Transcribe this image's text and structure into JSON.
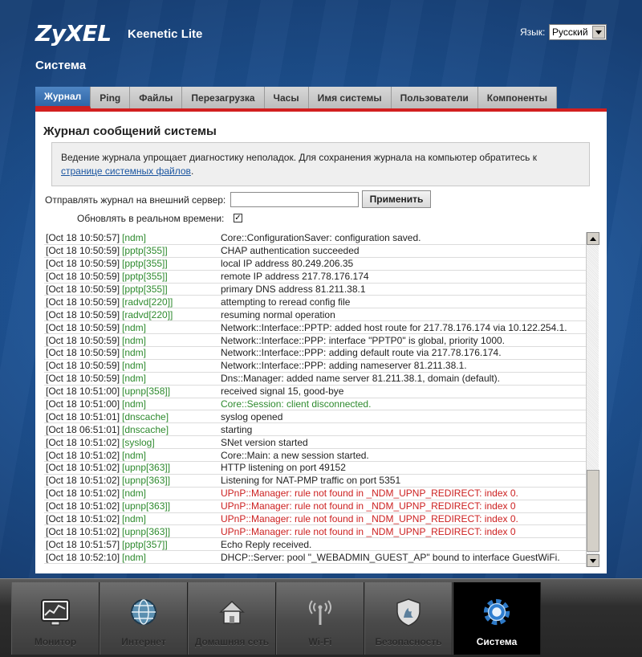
{
  "header": {
    "brand": "ZyXEL",
    "model": "Keenetic Lite",
    "language_label": "Язык:",
    "language_value": "Русский",
    "section_title": "Система"
  },
  "tabs": [
    {
      "label": "Журнал",
      "active": true
    },
    {
      "label": "Ping",
      "active": false
    },
    {
      "label": "Файлы",
      "active": false
    },
    {
      "label": "Перезагрузка",
      "active": false
    },
    {
      "label": "Часы",
      "active": false
    },
    {
      "label": "Имя системы",
      "active": false
    },
    {
      "label": "Пользователи",
      "active": false
    },
    {
      "label": "Компоненты",
      "active": false
    }
  ],
  "panel": {
    "title": "Журнал сообщений системы",
    "info_text": "Ведение журнала упрощает диагностику неполадок. Для сохранения журнала на компьютер обратитесь к ",
    "info_link": "странице системных файлов",
    "info_tail": ".",
    "send_label": "Отправлять журнал на внешний сервер:",
    "send_value": "",
    "apply_label": "Применить",
    "realtime_label": "Обновлять в реальном времени:",
    "realtime_checked": true,
    "realtime_mark": "✓"
  },
  "log": [
    {
      "ts": "[Oct 18 10:50:57]",
      "src": "[ndm]",
      "msg": "Core::ConfigurationSaver: configuration saved.",
      "level": "normal"
    },
    {
      "ts": "[Oct 18 10:50:59]",
      "src": "[pptp[355]]",
      "msg": "CHAP authentication succeeded",
      "level": "normal"
    },
    {
      "ts": "[Oct 18 10:50:59]",
      "src": "[pptp[355]]",
      "msg": "local IP address 80.249.206.35",
      "level": "normal"
    },
    {
      "ts": "[Oct 18 10:50:59]",
      "src": "[pptp[355]]",
      "msg": "remote IP address 217.78.176.174",
      "level": "normal"
    },
    {
      "ts": "[Oct 18 10:50:59]",
      "src": "[pptp[355]]",
      "msg": "primary DNS address 81.211.38.1",
      "level": "normal"
    },
    {
      "ts": "[Oct 18 10:50:59]",
      "src": "[radvd[220]]",
      "msg": "attempting to reread config file",
      "level": "normal"
    },
    {
      "ts": "[Oct 18 10:50:59]",
      "src": "[radvd[220]]",
      "msg": "resuming normal operation",
      "level": "normal"
    },
    {
      "ts": "[Oct 18 10:50:59]",
      "src": "[ndm]",
      "msg": "Network::Interface::PPTP: added host route for 217.78.176.174 via 10.122.254.1.",
      "level": "normal"
    },
    {
      "ts": "[Oct 18 10:50:59]",
      "src": "[ndm]",
      "msg": "Network::Interface::PPP: interface \"PPTP0\" is global, priority 1000.",
      "level": "normal"
    },
    {
      "ts": "[Oct 18 10:50:59]",
      "src": "[ndm]",
      "msg": "Network::Interface::PPP: adding default route via 217.78.176.174.",
      "level": "normal"
    },
    {
      "ts": "[Oct 18 10:50:59]",
      "src": "[ndm]",
      "msg": "Network::Interface::PPP: adding nameserver 81.211.38.1.",
      "level": "normal"
    },
    {
      "ts": "[Oct 18 10:50:59]",
      "src": "[ndm]",
      "msg": "Dns::Manager: added name server 81.211.38.1, domain (default).",
      "level": "normal"
    },
    {
      "ts": "[Oct 18 10:51:00]",
      "src": "[upnp[358]]",
      "msg": "received signal 15, good-bye",
      "level": "normal"
    },
    {
      "ts": "[Oct 18 10:51:00]",
      "src": "[ndm]",
      "msg": "Core::Session: client disconnected.",
      "level": "ok"
    },
    {
      "ts": "[Oct 18 10:51:01]",
      "src": "[dnscache]",
      "msg": "syslog opened",
      "level": "normal"
    },
    {
      "ts": "[Oct 18 06:51:01]",
      "src": "[dnscache]",
      "msg": "starting",
      "level": "normal"
    },
    {
      "ts": "[Oct 18 10:51:02]",
      "src": "[syslog]",
      "msg": "SNet version started",
      "level": "normal"
    },
    {
      "ts": "[Oct 18 10:51:02]",
      "src": "[ndm]",
      "msg": "Core::Main: a new session started.",
      "level": "normal"
    },
    {
      "ts": "[Oct 18 10:51:02]",
      "src": "[upnp[363]]",
      "msg": "HTTP listening on port 49152",
      "level": "normal"
    },
    {
      "ts": "[Oct 18 10:51:02]",
      "src": "[upnp[363]]",
      "msg": "Listening for NAT-PMP traffic on port 5351",
      "level": "normal"
    },
    {
      "ts": "[Oct 18 10:51:02]",
      "src": "[ndm]",
      "msg": "UPnP::Manager: rule not found in _NDM_UPNP_REDIRECT: index 0.",
      "level": "err"
    },
    {
      "ts": "[Oct 18 10:51:02]",
      "src": "[upnp[363]]",
      "msg": "UPnP::Manager: rule not found in _NDM_UPNP_REDIRECT: index 0",
      "level": "err"
    },
    {
      "ts": "[Oct 18 10:51:02]",
      "src": "[ndm]",
      "msg": "UPnP::Manager: rule not found in _NDM_UPNP_REDIRECT: index 0.",
      "level": "err"
    },
    {
      "ts": "[Oct 18 10:51:02]",
      "src": "[upnp[363]]",
      "msg": "UPnP::Manager: rule not found in _NDM_UPNP_REDIRECT: index 0",
      "level": "err"
    },
    {
      "ts": "[Oct 18 10:51:57]",
      "src": "[pptp[357]]",
      "msg": "Echo Reply received.",
      "level": "normal"
    },
    {
      "ts": "[Oct 18 10:52:10]",
      "src": "[ndm]",
      "msg": "DHCP::Server: pool \"_WEBADMIN_GUEST_AP\" bound to interface GuestWiFi.",
      "level": "normal"
    }
  ],
  "dock": [
    {
      "label": "Монитор",
      "icon": "monitor-icon",
      "active": false
    },
    {
      "label": "Интернет",
      "icon": "globe-icon",
      "active": false
    },
    {
      "label": "Домашняя сеть",
      "icon": "home-icon",
      "active": false
    },
    {
      "label": "Wi-Fi",
      "icon": "wifi-icon",
      "active": false
    },
    {
      "label": "Безопасность",
      "icon": "shield-icon",
      "active": false
    },
    {
      "label": "Система",
      "icon": "gear-icon",
      "active": true
    }
  ],
  "colors": {
    "accent_red": "#d21f1f",
    "tab_active": "#3a72b4",
    "source_green": "#2e8a2e",
    "error_red": "#cc1f1f"
  }
}
